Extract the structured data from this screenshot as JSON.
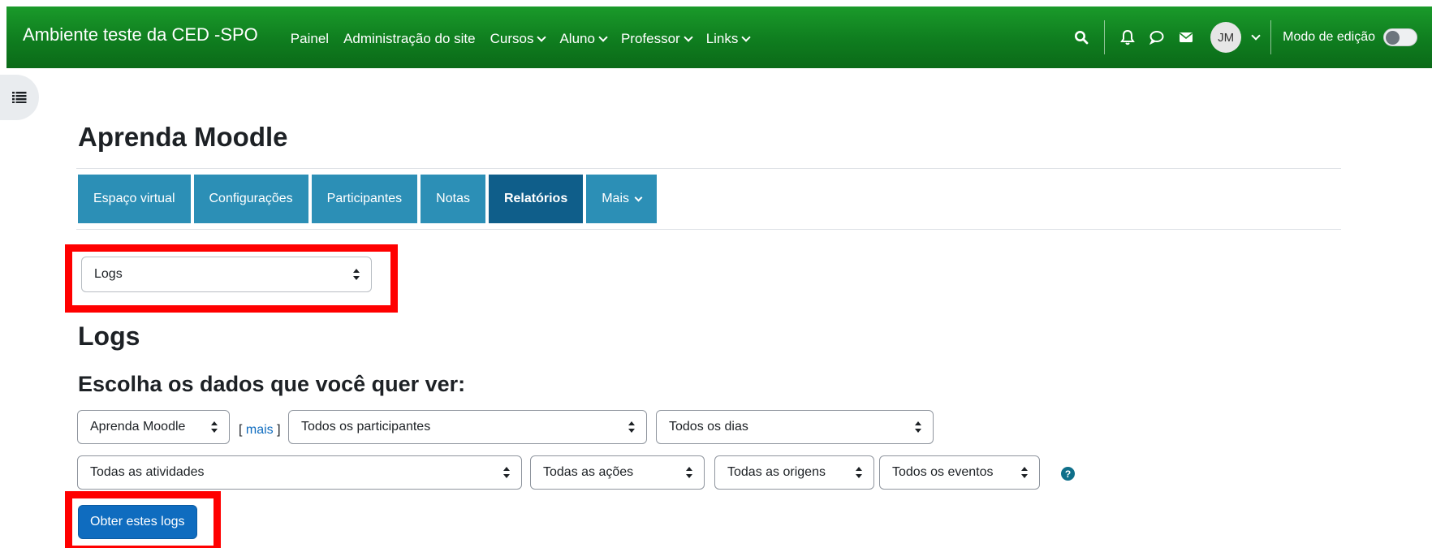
{
  "navbar": {
    "brand": "Ambiente teste da CED -SPO",
    "links": [
      {
        "label": "Painel",
        "has_caret": false
      },
      {
        "label": "Administração do site",
        "has_caret": false
      },
      {
        "label": "Cursos",
        "has_caret": true
      },
      {
        "label": "Aluno",
        "has_caret": true
      },
      {
        "label": "Professor",
        "has_caret": true
      },
      {
        "label": "Links",
        "has_caret": true
      }
    ],
    "icons": [
      "search-icon",
      "bell-icon",
      "chat-icon",
      "envelope-icon"
    ],
    "user_initials": "JM",
    "edit_mode_label": "Modo de edição",
    "edit_mode_on": false,
    "color": "#11851f"
  },
  "course": {
    "title": "Aprenda Moodle"
  },
  "tabs": [
    {
      "label": "Espaço virtual",
      "active": false
    },
    {
      "label": "Configurações",
      "active": false
    },
    {
      "label": "Participantes",
      "active": false
    },
    {
      "label": "Notas",
      "active": false
    },
    {
      "label": "Relatórios",
      "active": true
    },
    {
      "label": "Mais",
      "active": false,
      "has_caret": true
    }
  ],
  "report_select": {
    "value": "Logs"
  },
  "page": {
    "heading": "Logs",
    "subheading": "Escolha os dados que você quer ver:"
  },
  "filters": {
    "course": "Aprenda Moodle",
    "more_link_open": "[ ",
    "more_link": "mais",
    "more_link_close": " ]",
    "participants": "Todos os participantes",
    "days": "Todos os dias",
    "activities": "Todas as atividades",
    "actions": "Todas as ações",
    "origins": "Todas as origens",
    "events": "Todos os eventos",
    "help_icon": "question-icon"
  },
  "submit": {
    "label": "Obter estes logs"
  },
  "colors": {
    "tab": "#2c8fb6",
    "tab_active": "#0f5e8a",
    "primary": "#0f6cbf",
    "highlight": "#ff0000"
  }
}
